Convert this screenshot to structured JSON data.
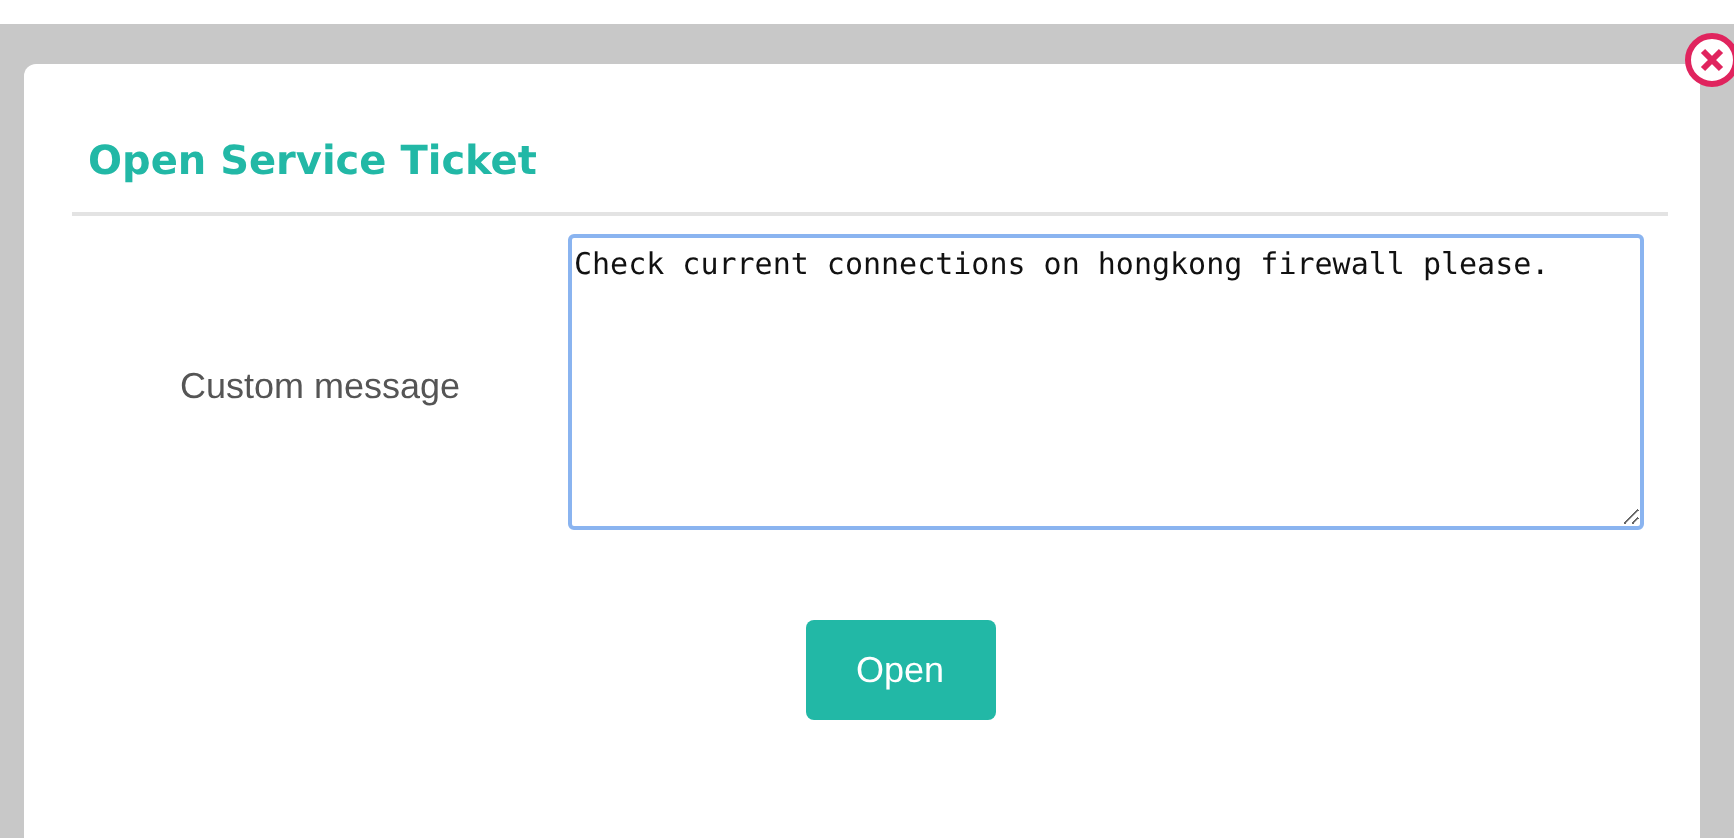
{
  "dialog": {
    "title": "Open Service Ticket",
    "fields": [
      {
        "label": "Custom message",
        "value": "Check current connections on hongkong firewall please."
      }
    ],
    "buttons": [
      "Open"
    ]
  }
}
